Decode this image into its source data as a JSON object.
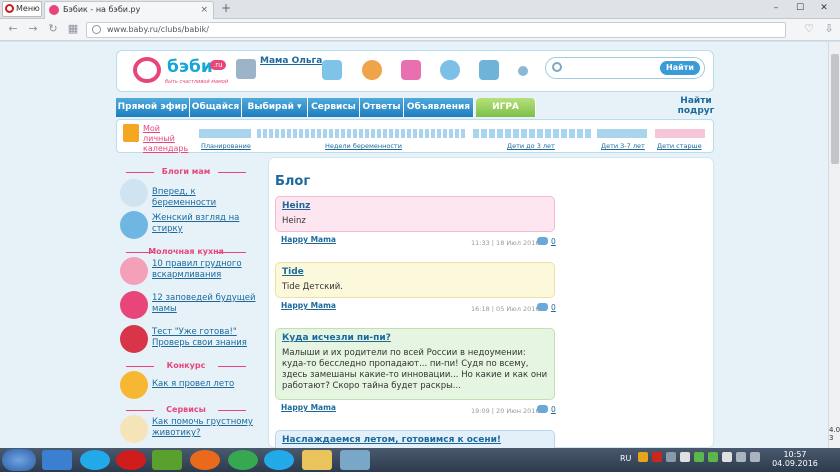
{
  "browser": {
    "menu_label": "Меню",
    "tab_title": "Бэбик - на бэби.ру",
    "tab_close": "×",
    "new_tab": "+",
    "win_min": "–",
    "win_max": "☐",
    "win_close": "✕",
    "url": "www.baby.ru/clubs/babik/"
  },
  "header": {
    "logo_text": "бэби",
    "logo_ru": ".ru",
    "logo_slogan": "быть счастливой мамой",
    "user_name": "Мама Ольга",
    "search_placeholder": "",
    "search_button": "Найти"
  },
  "nav": {
    "items": [
      "Прямой эфир",
      "Общайся",
      "Выбирай ▾",
      "Сервисы",
      "Ответы",
      "Объявления",
      "ИГРА"
    ],
    "find_friends": "Найти подруг"
  },
  "timeline": {
    "calendar_link": "Мой личный календарь",
    "labels": [
      "Планирование",
      "Недели беременности",
      "Дети до 3 лет",
      "Дети 3-7 лет",
      "Дети старше"
    ]
  },
  "sidebar": {
    "sections": [
      {
        "heading": "Блоги мам",
        "items": [
          "Вперед, к беременности",
          "Женский взгляд на стирку"
        ]
      },
      {
        "heading": "Молочная кухня",
        "items": [
          "10 правил грудного вскармливания",
          "12 заповедей будущей мамы",
          "Тест \"Уже готова!\" Проверь свои знания"
        ]
      },
      {
        "heading": "Конкурс",
        "items": [
          "Как я провел лето"
        ]
      },
      {
        "heading": "Сервисы",
        "items": [
          "Как помочь грустному животику?"
        ]
      }
    ]
  },
  "blog": {
    "title": "Блог",
    "posts": [
      {
        "title": "Heinz",
        "body": "Heinz",
        "user": "Happy Mama",
        "date": "11:33 | 18 Июл 2016",
        "comments": "0",
        "bg": "#fde6f0",
        "border": "#f3bcd3"
      },
      {
        "title": "Tide",
        "body": "Tide Детский.",
        "user": "Happy Mama",
        "date": "16:18 | 05 Июл 2016",
        "comments": "0",
        "bg": "#fcf8dc",
        "border": "#ece3a0"
      },
      {
        "title": "Куда исчезли пи-пи?",
        "body": "Малыши и их родители по всей России в недоумении: куда-то бесследно пропадают... пи-пи! Судя по всему, здесь замешаны какие-то инновации... Но какие и как они работают? Скоро тайна будет раскры...",
        "user": "Happy Mama",
        "date": "19:09 | 20 Июн 2016",
        "comments": "0",
        "bg": "#e6f5e1",
        "border": "#bfe0b1"
      },
      {
        "title": "Наслаждаемся летом, готовимся к осени!",
        "body": "",
        "user": "",
        "date": "",
        "comments": "",
        "bg": "#e3f0fa",
        "border": "#b7d6ec"
      }
    ]
  },
  "taskbar": {
    "lang": "RU",
    "time": "10:57",
    "date": "04.09.2016"
  },
  "scroll": {
    "side_text": "4.0 3"
  }
}
